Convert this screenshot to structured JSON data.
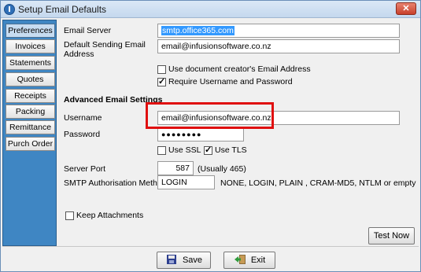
{
  "window": {
    "title": "Setup Email Defaults",
    "close_label": "✕"
  },
  "sidebar": {
    "items": [
      {
        "label": "Preferences",
        "active": true
      },
      {
        "label": "Invoices"
      },
      {
        "label": "Statements"
      },
      {
        "label": "Quotes"
      },
      {
        "label": "Receipts"
      },
      {
        "label": "Packing Slips"
      },
      {
        "label": "Remittance"
      },
      {
        "label": "Purch Order"
      }
    ]
  },
  "form": {
    "email_server_label": "Email Server",
    "email_server_value": "smtp.office365.com",
    "default_sending_label_1": "Default Sending Email",
    "default_sending_label_2": "Address",
    "default_sending_value": "email@infusionsoftware.co.nz",
    "use_creator_label": "Use document creator's Email Address",
    "use_creator_checked": false,
    "require_auth_label": "Require Username and Password",
    "require_auth_checked": true,
    "advanced_heading": "Advanced Email Settings",
    "username_label": "Username",
    "username_value": "email@infusionsoftware.co.nz",
    "password_label": "Password",
    "password_value": "●●●●●●●●",
    "use_ssl_label": "Use SSL",
    "use_ssl_checked": false,
    "use_tls_label": "Use TLS",
    "use_tls_checked": true,
    "server_port_label": "Server Port",
    "server_port_value": "587",
    "server_port_hint": "(Usually 465)",
    "smtp_auth_label": "SMTP Authorisation Method",
    "smtp_auth_value": "LOGIN",
    "smtp_auth_hint": "NONE,  LOGIN,  PLAIN ,  CRAM-MD5,  NTLM or empty",
    "keep_attachments_label": "Keep Attachments",
    "keep_attachments_checked": false,
    "test_now_label": "Test Now"
  },
  "footer": {
    "save_label": "Save",
    "exit_label": "Exit"
  },
  "colors": {
    "sidebar": "#3f86c3",
    "highlight": "#e01010",
    "selection": "#3399ff"
  }
}
